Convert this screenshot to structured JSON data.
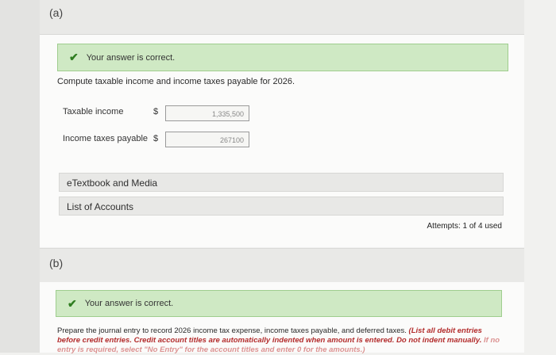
{
  "part_a": {
    "label": "(a)",
    "feedback": "Your answer is correct.",
    "question": "Compute taxable income and income taxes payable for 2026.",
    "rows": [
      {
        "label": "Taxable income",
        "currency": "$",
        "value": "1,335,500"
      },
      {
        "label": "Income taxes payable",
        "currency": "$",
        "value": "267100"
      }
    ],
    "links": {
      "etextbook": "eTextbook and Media",
      "accounts": "List of Accounts"
    },
    "attempts": "Attempts: 1 of 4 used"
  },
  "part_b": {
    "label": "(b)",
    "feedback": "Your answer is correct.",
    "instructions_plain": "Prepare the journal entry to record 2026 income tax expense, income taxes payable, and deferred taxes. ",
    "instructions_emph": "(List all debit entries before credit entries. Credit account titles are automatically indented when amount is entered. Do not indent manually.",
    "instructions_faded": "If no entry is required, select \"No Entry\" for the account titles and enter 0 for the amounts.)"
  },
  "colors": {
    "success_bg": "#cfe9c4",
    "success_border": "#9fcd8e",
    "check": "#2f7d20",
    "emphasis": "#b32d2d"
  },
  "icons": {
    "check": "check-icon"
  }
}
